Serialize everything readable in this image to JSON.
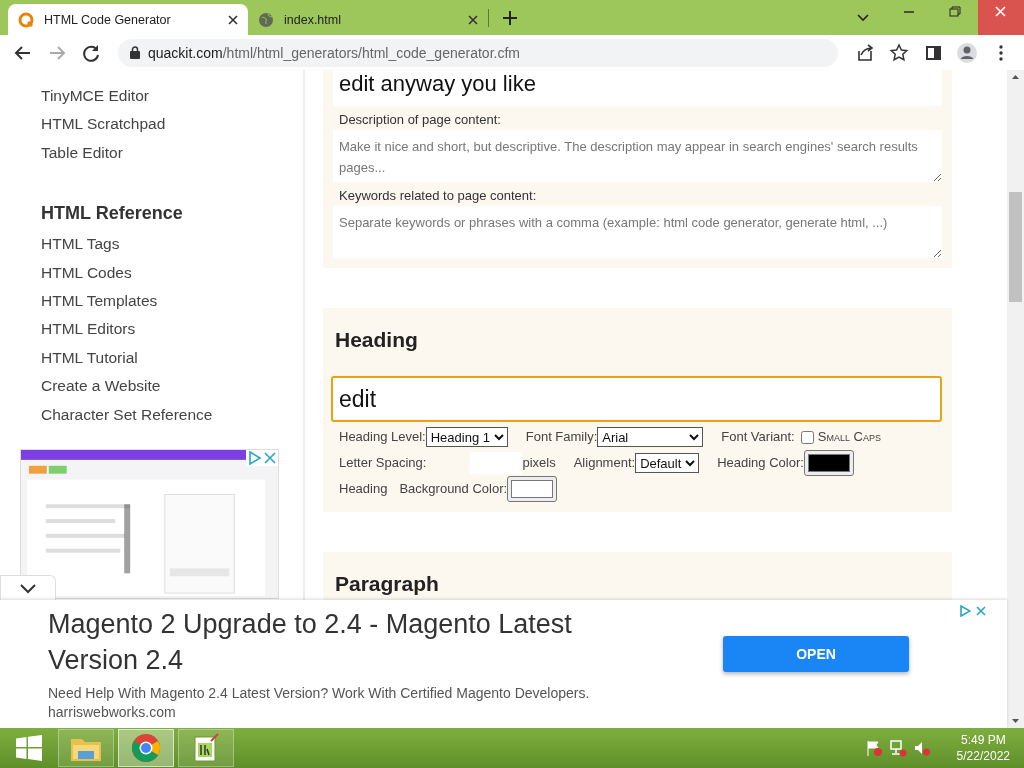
{
  "browser": {
    "tabs": [
      {
        "title": "HTML Code Generator",
        "selected": true
      },
      {
        "title": "index.html",
        "selected": false
      }
    ],
    "address": {
      "host": "quackit.com",
      "path": "/html/html_generators/html_code_generator.cfm"
    }
  },
  "sidebar": {
    "items": [
      "TinyMCE Editor",
      "HTML Scratchpad",
      "Table Editor"
    ],
    "heading": "HTML Reference",
    "reference_items": [
      "HTML Tags",
      "HTML Codes",
      "HTML Templates",
      "HTML Editors",
      "HTML Tutorial",
      "Create a Website",
      "Character Set Reference"
    ]
  },
  "meta_section": {
    "title_value": "edit anyway you like",
    "fields": [
      {
        "label": "Description of page content:",
        "placeholder": "Make it nice and short, but descriptive. The description may appear in search engines' search results pages..."
      },
      {
        "label": "Keywords related to page content:",
        "placeholder": "Separate keywords or phrases with a comma (example: html code generator, generate html, ...)"
      }
    ]
  },
  "heading_section": {
    "title": "Heading",
    "value": "edit",
    "options": [
      {
        "kind": "select",
        "label": "Heading Level:",
        "value": "Heading 1"
      },
      {
        "kind": "select",
        "label": "Font Family:",
        "value": "Arial"
      },
      {
        "kind": "checkbox",
        "label": "Font Variant:",
        "option": "Small Caps",
        "checked": false
      },
      {
        "kind": "number",
        "label": "Letter Spacing:",
        "unit": "pixels"
      },
      {
        "kind": "select",
        "label": "Alignment:",
        "value": "Default"
      },
      {
        "kind": "color",
        "label": "Heading Color:",
        "color": "#000000"
      },
      {
        "kind": "text",
        "label": "Heading"
      },
      {
        "kind": "color",
        "label": "Background Color:",
        "color": "#ffffff"
      }
    ]
  },
  "paragraph_section": {
    "title": "Paragraph"
  },
  "ad": {
    "title": "Magento 2 Upgrade to 2.4 - Magento Latest Version 2.4",
    "text": "Need Help With Magento 2.4 Latest Version? Work With Certified Magento Developers.",
    "domain": "harriswebworks.com",
    "button": "OPEN"
  },
  "taskbar": {
    "apps": [
      {
        "kind": "folder",
        "selected": false
      },
      {
        "kind": "chrome",
        "selected": true
      },
      {
        "kind": "notepad",
        "selected": false
      }
    ],
    "time": "5:49 PM",
    "date": "5/22/2022"
  }
}
